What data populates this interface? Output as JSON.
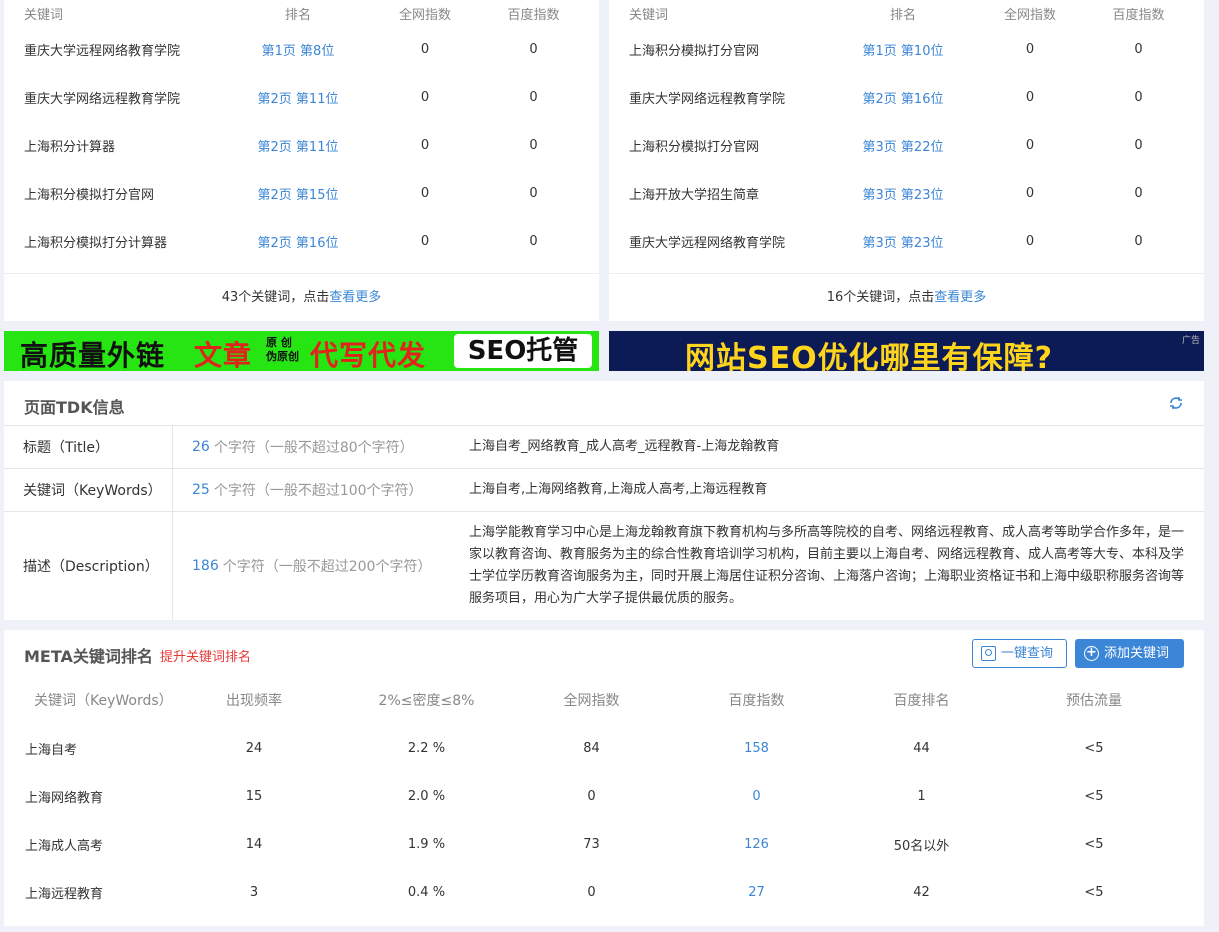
{
  "kw_left": {
    "headers": [
      "关键词",
      "排名",
      "全网指数",
      "百度指数"
    ],
    "rows": [
      {
        "keyword": "重庆大学远程网络教育学院",
        "rank": "第1页 第8位",
        "all_index": "0",
        "baidu_index": "0"
      },
      {
        "keyword": "重庆大学网络远程教育学院",
        "rank": "第2页 第11位",
        "all_index": "0",
        "baidu_index": "0"
      },
      {
        "keyword": "上海积分计算器",
        "rank": "第2页 第11位",
        "all_index": "0",
        "baidu_index": "0"
      },
      {
        "keyword": "上海积分模拟打分官网",
        "rank": "第2页 第15位",
        "all_index": "0",
        "baidu_index": "0"
      },
      {
        "keyword": "上海积分模拟打分计算器",
        "rank": "第2页 第16位",
        "all_index": "0",
        "baidu_index": "0"
      }
    ],
    "footer_text": "43个关键词，点击",
    "footer_link": "查看更多"
  },
  "kw_right": {
    "headers": [
      "关键词",
      "排名",
      "全网指数",
      "百度指数"
    ],
    "rows": [
      {
        "keyword": "上海积分模拟打分官网",
        "rank": "第1页 第10位",
        "all_index": "0",
        "baidu_index": "0"
      },
      {
        "keyword": "重庆大学网络远程教育学院",
        "rank": "第2页 第16位",
        "all_index": "0",
        "baidu_index": "0"
      },
      {
        "keyword": "上海积分模拟打分官网",
        "rank": "第3页 第22位",
        "all_index": "0",
        "baidu_index": "0"
      },
      {
        "keyword": "上海开放大学招生简章",
        "rank": "第3页 第23位",
        "all_index": "0",
        "baidu_index": "0"
      },
      {
        "keyword": "重庆大学远程网络教育学院",
        "rank": "第3页 第23位",
        "all_index": "0",
        "baidu_index": "0"
      }
    ],
    "footer_text": "16个关键词，点击",
    "footer_link": "查看更多"
  },
  "ads": {
    "left": {
      "part1": "高质量外链",
      "part2": "文章",
      "part2_small": "原 创\n伪原创",
      "part3": "代写代发",
      "part4": "SEO托管",
      "bg": "#27e512"
    },
    "right": {
      "text": "网站SEO优化哪里有保障?",
      "tag": "广告",
      "bg": "#0c1a55"
    }
  },
  "tdk": {
    "title": "页面TDK信息",
    "refresh_icon": "refresh-icon",
    "rows": [
      {
        "label": "标题（Title）",
        "count": "26",
        "count_note": "个字符（一般不超过80个字符）",
        "value": "上海自考_网络教育_成人高考_远程教育-上海龙翰教育"
      },
      {
        "label": "关键词（KeyWords）",
        "count": "25",
        "count_note": "个字符（一般不超过100个字符）",
        "value": "上海自考,上海网络教育,上海成人高考,上海远程教育"
      },
      {
        "label": "描述（Description）",
        "count": "186",
        "count_note": "个字符（一般不超过200个字符）",
        "value": "上海学能教育学习中心是上海龙翰教育旗下教育机构与多所高等院校的自考、网络远程教育、成人高考等助学合作多年，是一家以教育咨询、教育服务为主的综合性教育培训学习机构，目前主要以上海自考、网络远程教育、成人高考等大专、本科及学士学位学历教育咨询服务为主，同时开展上海居住证积分咨询、上海落户咨询；上海职业资格证书和上海中级职称服务咨询等服务项目，用心为广大学子提供最优质的服务。"
      }
    ]
  },
  "meta": {
    "title": "META关键词排名",
    "promo_link": "提升关键词排名",
    "btn_query": "一键查询",
    "btn_add": "添加关键词",
    "headers": [
      "关键词（KeyWords）",
      "出现频率",
      "2%≤密度≤8%",
      "全网指数",
      "百度指数",
      "百度排名",
      "预估流量"
    ],
    "rows": [
      {
        "keyword": "上海自考",
        "freq": "24",
        "density": "2.2 %",
        "all_index": "84",
        "baidu_index": "158",
        "baidu_rank": "44",
        "traffic": "<5"
      },
      {
        "keyword": "上海网络教育",
        "freq": "15",
        "density": "2.0 %",
        "all_index": "0",
        "baidu_index": "0",
        "baidu_rank": "1",
        "traffic": "<5"
      },
      {
        "keyword": "上海成人高考",
        "freq": "14",
        "density": "1.9 %",
        "all_index": "73",
        "baidu_index": "126",
        "baidu_rank": "50名以外",
        "traffic": "<5"
      },
      {
        "keyword": "上海远程教育",
        "freq": "3",
        "density": "0.4 %",
        "all_index": "0",
        "baidu_index": "27",
        "baidu_rank": "42",
        "traffic": "<5"
      }
    ]
  },
  "colors": {
    "link_blue": "#3b86d6",
    "promo_red": "#e53935",
    "bg": "#eef2f8"
  }
}
